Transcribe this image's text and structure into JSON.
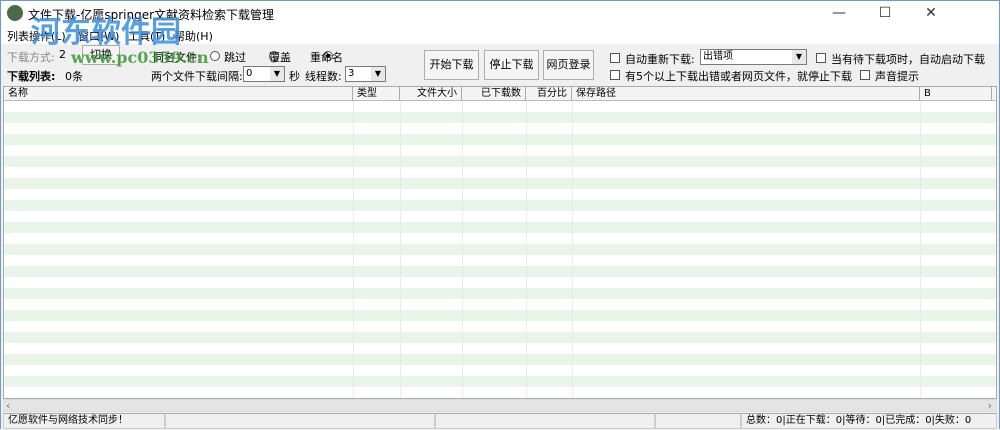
{
  "window": {
    "title": "文件下载-亿愿springer文献资料检索下载管理",
    "minimize": "—",
    "maximize": "☐",
    "close": "✕"
  },
  "menu": [
    "列表操作(L)",
    "窗口(W)",
    "工具(T)",
    "帮助(H)"
  ],
  "toolbar": {
    "mode_label": "下载方式:",
    "mode_value": "2",
    "switch": "切换",
    "same_name_label": "同名文件:",
    "radio_skip": "跳过",
    "radio_overwrite": "覆盖",
    "radio_rename": "重命名",
    "selected": "重命名",
    "list_label": "下载列表:",
    "list_count": "0条",
    "interval_label": "两个文件下载间隔:",
    "interval_value": "0",
    "seconds": "秒",
    "threads_label": "线程数:",
    "threads_value": "3",
    "start": "开始下载",
    "stop": "停止下载",
    "login": "网页登录",
    "auto_retry_label": "自动重新下载:",
    "auto_retry_value": "出错项",
    "auto_start_label": "当有待下载项时，自动启动下载",
    "stop_on_errors_label": "有5个以上下载出错或者网页文件，就停止下载",
    "sound_label": "声音提示"
  },
  "columns": [
    "名称",
    "类型",
    "文件大小",
    "已下载数",
    "百分比",
    "保存路径",
    "B"
  ],
  "status": {
    "left": "亿愿软件与网络技术同步！",
    "counts": "总数：0|正在下载：0|等待：0|已完成：0|失败：0"
  },
  "watermark": {
    "text": "河东软件园",
    "url": "www.pc0359.cn"
  }
}
